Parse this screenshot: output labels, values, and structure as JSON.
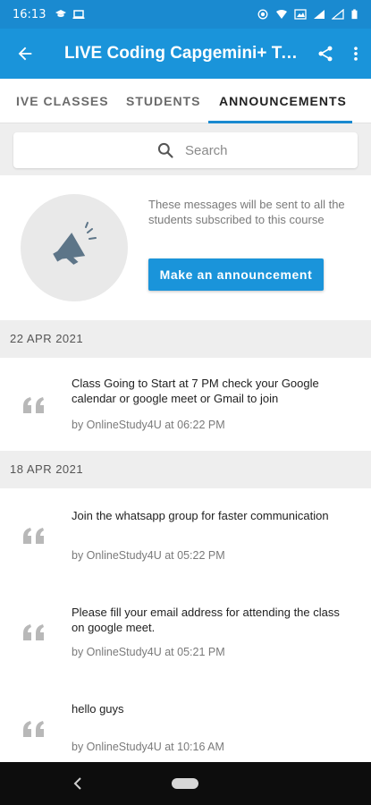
{
  "status_bar": {
    "time": "16:13"
  },
  "app_bar": {
    "title": "LIVE Coding Capgemini+ Tech Mahindra"
  },
  "tabs": [
    {
      "label": "IVE CLASSES"
    },
    {
      "label": "STUDENTS"
    },
    {
      "label": "ANNOUNCEMENTS"
    }
  ],
  "search": {
    "placeholder": "Search"
  },
  "promo": {
    "description": "These messages will be sent to all the students subscribed to this course",
    "button_label": "Make an announcement"
  },
  "groups": [
    {
      "date": "22  APR  2021",
      "items": [
        {
          "message": "Class Going to Start at 7 PM check your Google calendar or google meet or Gmail  to join",
          "meta": "by OnlineStudy4U at 06:22 PM"
        }
      ]
    },
    {
      "date": "18  APR  2021",
      "items": [
        {
          "message": "Join the whatsapp group for faster communication",
          "meta": "by OnlineStudy4U at 05:22 PM"
        },
        {
          "message": "Please fill your email address for attending the class on google meet.",
          "meta": "by OnlineStudy4U at 05:21 PM"
        },
        {
          "message": "hello guys",
          "meta": "by OnlineStudy4U at 10:16 AM"
        }
      ]
    }
  ],
  "colors": {
    "primary": "#1a94da",
    "status_bar": "#1a8ad0",
    "divider_bg": "#eeeeee"
  },
  "icons": [
    "back-arrow-icon",
    "share-icon",
    "more-vert-icon",
    "search-icon",
    "megaphone-icon",
    "quote-icon"
  ]
}
